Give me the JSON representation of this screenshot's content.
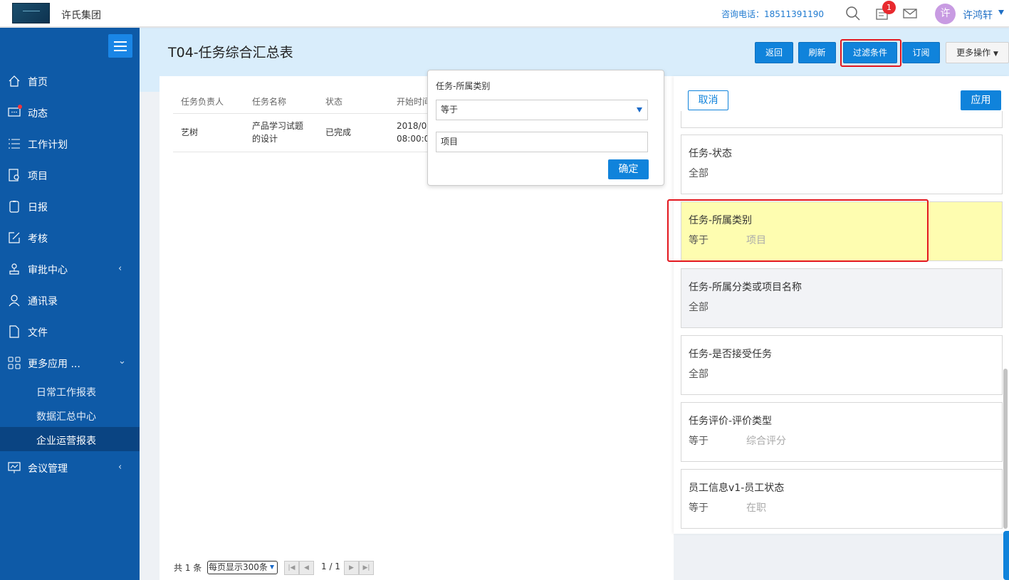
{
  "topbar": {
    "company": "许氏集团",
    "hotline": "咨询电话：18511391190",
    "notification_count": "1",
    "avatar_text": "许",
    "username": "许鸿轩"
  },
  "sidebar": {
    "items": [
      {
        "label": "首页",
        "icon": "home-icon"
      },
      {
        "label": "动态",
        "icon": "chat-icon"
      },
      {
        "label": "工作计划",
        "icon": "list-icon"
      },
      {
        "label": "项目",
        "icon": "project-icon"
      },
      {
        "label": "日报",
        "icon": "clipboard-icon"
      },
      {
        "label": "考核",
        "icon": "edit-icon"
      },
      {
        "label": "审批中心",
        "icon": "stamp-icon"
      },
      {
        "label": "通讯录",
        "icon": "user-icon"
      },
      {
        "label": "文件",
        "icon": "file-icon"
      },
      {
        "label": "更多应用 ...",
        "icon": "apps-icon"
      }
    ],
    "subitems": [
      {
        "label": "日常工作报表"
      },
      {
        "label": "数据汇总中心"
      },
      {
        "label": "企业运营报表",
        "active": true
      }
    ],
    "meeting": {
      "label": "会议管理",
      "icon": "meeting-icon"
    }
  },
  "header": {
    "title": "T04-任务综合汇总表",
    "buttons": {
      "back": "返回",
      "refresh": "刷新",
      "filter": "过滤条件",
      "subscribe": "订阅",
      "more": "更多操作"
    }
  },
  "table": {
    "headers": [
      "任务负责人",
      "任务名称",
      "状态",
      "开始时间"
    ],
    "rows": [
      {
        "owner": "艺树",
        "name_line1": "产品学习试题",
        "name_line2": "的设计",
        "status": "已完成",
        "start_line1": "2018/07",
        "start_line2": "08:00:00"
      }
    ]
  },
  "pagination": {
    "total": "共 1 条",
    "page_size": "每页显示300条",
    "page": "1 / 1"
  },
  "popover": {
    "title": "任务-所属类别",
    "operator": "等于",
    "value": "项目",
    "confirm": "确定"
  },
  "drawer": {
    "cancel": "取消",
    "apply": "应用",
    "filters": [
      {
        "title": "任务-状态",
        "operator": "全部",
        "value": ""
      },
      {
        "title": "任务-所属类别",
        "operator": "等于",
        "value": "项目"
      },
      {
        "title": "任务-所属分类或项目名称",
        "operator": "全部",
        "value": ""
      },
      {
        "title": "任务-是否接受任务",
        "operator": "全部",
        "value": ""
      },
      {
        "title": "任务评价-评价类型",
        "operator": "等于",
        "value": "综合评分"
      },
      {
        "title": "员工信息v1-员工状态",
        "operator": "等于",
        "value": "在职"
      }
    ]
  },
  "colors": {
    "sidebar": "#0e5aa7",
    "primary": "#1083db",
    "highlight": "#fefdb0",
    "annotation_red": "#e3171f"
  }
}
